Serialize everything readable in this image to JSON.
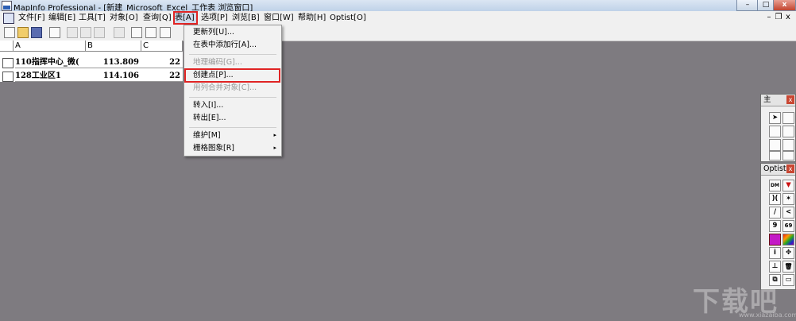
{
  "window": {
    "title": "MapInfo Professional - [新建_Microsoft_Excel_工作表 浏览窗口]"
  },
  "menubar": {
    "items": [
      "文件[F]",
      "编辑[E]",
      "工具[T]",
      "对象[O]",
      "查询[Q]",
      "表[A]",
      "选项[P]",
      "浏览[B]",
      "窗口[W]",
      "帮助[H]",
      "Optist[O]"
    ],
    "active_index": 5
  },
  "browser": {
    "columns": [
      "A",
      "B",
      "C"
    ],
    "rows": [
      {
        "a": "110指挥中心_微(",
        "b": "113.809",
        "c": "22"
      },
      {
        "a": "128工业区1",
        "b": "114.106",
        "c": "22"
      }
    ]
  },
  "dropdown": {
    "items": [
      {
        "label": "更新列[U]...",
        "disabled": false
      },
      {
        "label": "在表中添加行[A]...",
        "disabled": false
      },
      {
        "label": "地理编码[G]...",
        "disabled": true
      },
      {
        "label": "创建点[P]...",
        "disabled": false,
        "highlighted": true
      },
      {
        "label": "用列合并对象[C]...",
        "disabled": true
      },
      {
        "label": "转入[I]...",
        "disabled": false
      },
      {
        "label": "转出[E]...",
        "disabled": false
      },
      {
        "label": "维护[M]",
        "disabled": false,
        "submenu": true
      },
      {
        "label": "栅格图象[R]",
        "disabled": false,
        "submenu": true
      }
    ],
    "submenu_arrow": "▸"
  },
  "main_panel": {
    "title": "主",
    "close": "x"
  },
  "optist_panel": {
    "title": "Optist",
    "close": "x",
    "buttons": [
      "DM",
      "▼",
      ")(",
      "✶",
      "/",
      "<",
      "9",
      "69",
      "",
      "",
      "i",
      "✥",
      "⊥",
      "🗑",
      "⧉",
      "▭"
    ]
  },
  "window_buttons": {
    "minimize": "–",
    "maximize": "□",
    "close": "x"
  },
  "mdi_buttons": {
    "minimize": "–",
    "restore": "❐",
    "close": "x"
  },
  "watermark": {
    "text": "下载吧",
    "sub": "www.xiazaiba.com"
  }
}
